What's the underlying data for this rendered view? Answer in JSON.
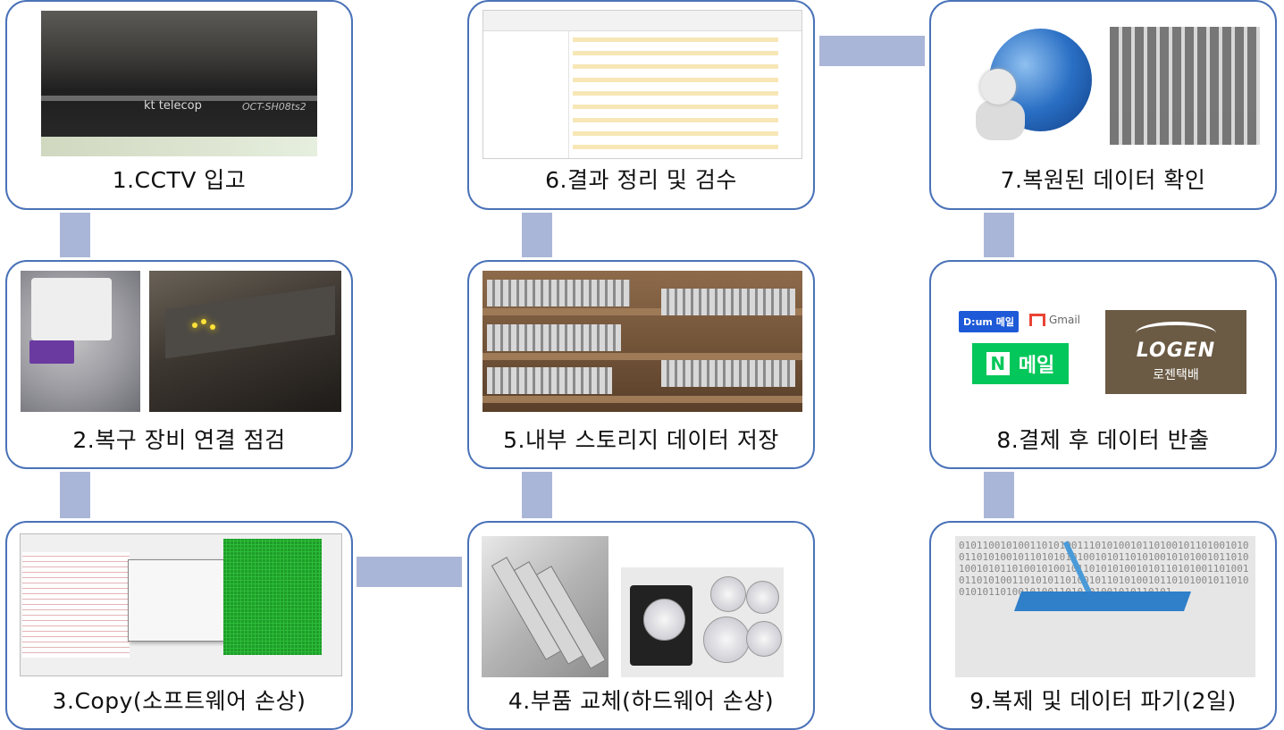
{
  "steps": {
    "s1": "1.CCTV 입고",
    "s2": "2.복구 장비 연결 점검",
    "s3": "3.Copy(소프트웨어 손상)",
    "s4": "4.부품 교체(하드웨어 손상)",
    "s5": "5.내부 스토리지 데이터 저장",
    "s6": "6.결과 정리 및 검수",
    "s7": "7.복원된 데이터 확인",
    "s8": "8.결제 후 데이터 반출",
    "s9": "9.복제 및 데이터 파기(2일)"
  },
  "photos": {
    "dvr_brand": "kt telecop",
    "dvr_model": "OCT-SH08ts2",
    "hdd_label": "WD Purple",
    "mail_daum": "D:um 메일",
    "mail_gmail": "Gmail",
    "mail_naver": "메일",
    "naver_n": "N",
    "logen_en": "LOGEN",
    "logen_kr": "로젠택배",
    "wipe_bits": "0101100101001101010011101010010110100101101001010011010100101101010101001010110101001010100101101010010101101001010010110101010010101101010011010010110101001101010110100101101010010110101001011010010101101001010011010101001010110101"
  },
  "colors": {
    "card_border": "#4a72b8",
    "connector": "#aab6d8"
  }
}
